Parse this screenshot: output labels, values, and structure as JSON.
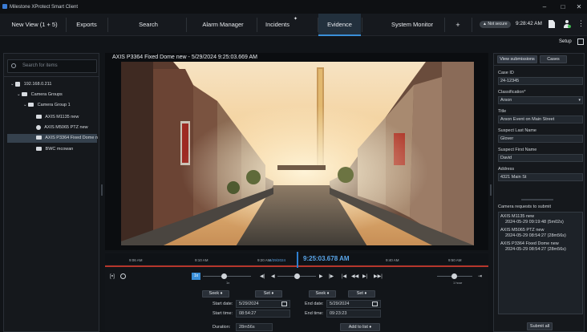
{
  "window": {
    "title": "Milestone XProtect Smart Client"
  },
  "nav": {
    "tabs": [
      {
        "label": "New View (1 + 5)"
      },
      {
        "label": "Exports"
      },
      {
        "label": "Search"
      },
      {
        "label": "Alarm Manager"
      },
      {
        "label": "Incidents"
      },
      {
        "label": "Evidence"
      },
      {
        "label": "System Monitor"
      },
      {
        "label": "+"
      }
    ],
    "active_tab": "Evidence",
    "status_badge": "Not secure",
    "clock": "9:28:42 AM",
    "setup_label": "Setup"
  },
  "left": {
    "search_placeholder": "Search for items",
    "tree": [
      {
        "label": "192.168.0.211"
      },
      {
        "label": "Camera Groups"
      },
      {
        "label": "Camera Group 1"
      },
      {
        "label": "AXIS M1135 new"
      },
      {
        "label": "AXIS M5065 PTZ new"
      },
      {
        "label": "AXIS P3364 Fixed Dome n"
      },
      {
        "label": "BWC mcowan"
      }
    ]
  },
  "video": {
    "title": "AXIS P3364 Fixed Dome new - 5/29/2024 9:25:03.669 AM"
  },
  "timeline": {
    "ticks": [
      "9:06 AM",
      "9:10 AM",
      "9:20 AM",
      "5/29/2024",
      "9:40 AM",
      "9:50 AM"
    ],
    "current_time": "9:25:03.678 AM",
    "speed_badge": "1x",
    "speed_label": "1x",
    "span_label": "1 hour"
  },
  "bottom": {
    "left": {
      "seek_label": "Seek",
      "set_label": "Set",
      "start_date_label": "Start date:",
      "start_date": "5/29/2024",
      "start_time_label": "Start time:",
      "start_time": "08:54:27"
    },
    "right": {
      "seek_label": "Seek",
      "set_label": "Set",
      "end_date_label": "End date:",
      "end_date": "5/29/2024",
      "end_time_label": "End time:",
      "end_time": "09:23:23"
    },
    "duration_label": "Duration:",
    "duration": "28m56s",
    "add_to_list": "Add to list"
  },
  "right": {
    "tab_view_submissions": "View submissions",
    "tab_cases": "Cases",
    "case_id_label": "Case ID",
    "case_id": "24-12345",
    "classification_label": "Classification*",
    "classification": "Arson",
    "title_label": "Title",
    "title": "Arson Event on Main Street",
    "suspect_last_label": "Suspect Last Name",
    "suspect_last": "Glover",
    "suspect_first_label": "Suspect First Name",
    "suspect_first": "David",
    "address_label": "Address",
    "address": "4321 Main St",
    "requests_label": "Camera requests to submit",
    "requests": [
      {
        "camera": "AXIS M1135 new",
        "range": "2024-05-29 09:19:48 (5m02s)"
      },
      {
        "camera": "AXIS M5065 PTZ new",
        "range": "2024-05-29 08:54:27 (28m56s)"
      },
      {
        "camera": "AXIS P3364 Fixed Dome new",
        "range": "2024-05-29 08:54:27 (28m56s)"
      }
    ],
    "submit_label": "Submit all"
  },
  "colors": {
    "accent": "#3a8fd8",
    "playhead": "#2f7fd0",
    "range": "#b5362c"
  }
}
